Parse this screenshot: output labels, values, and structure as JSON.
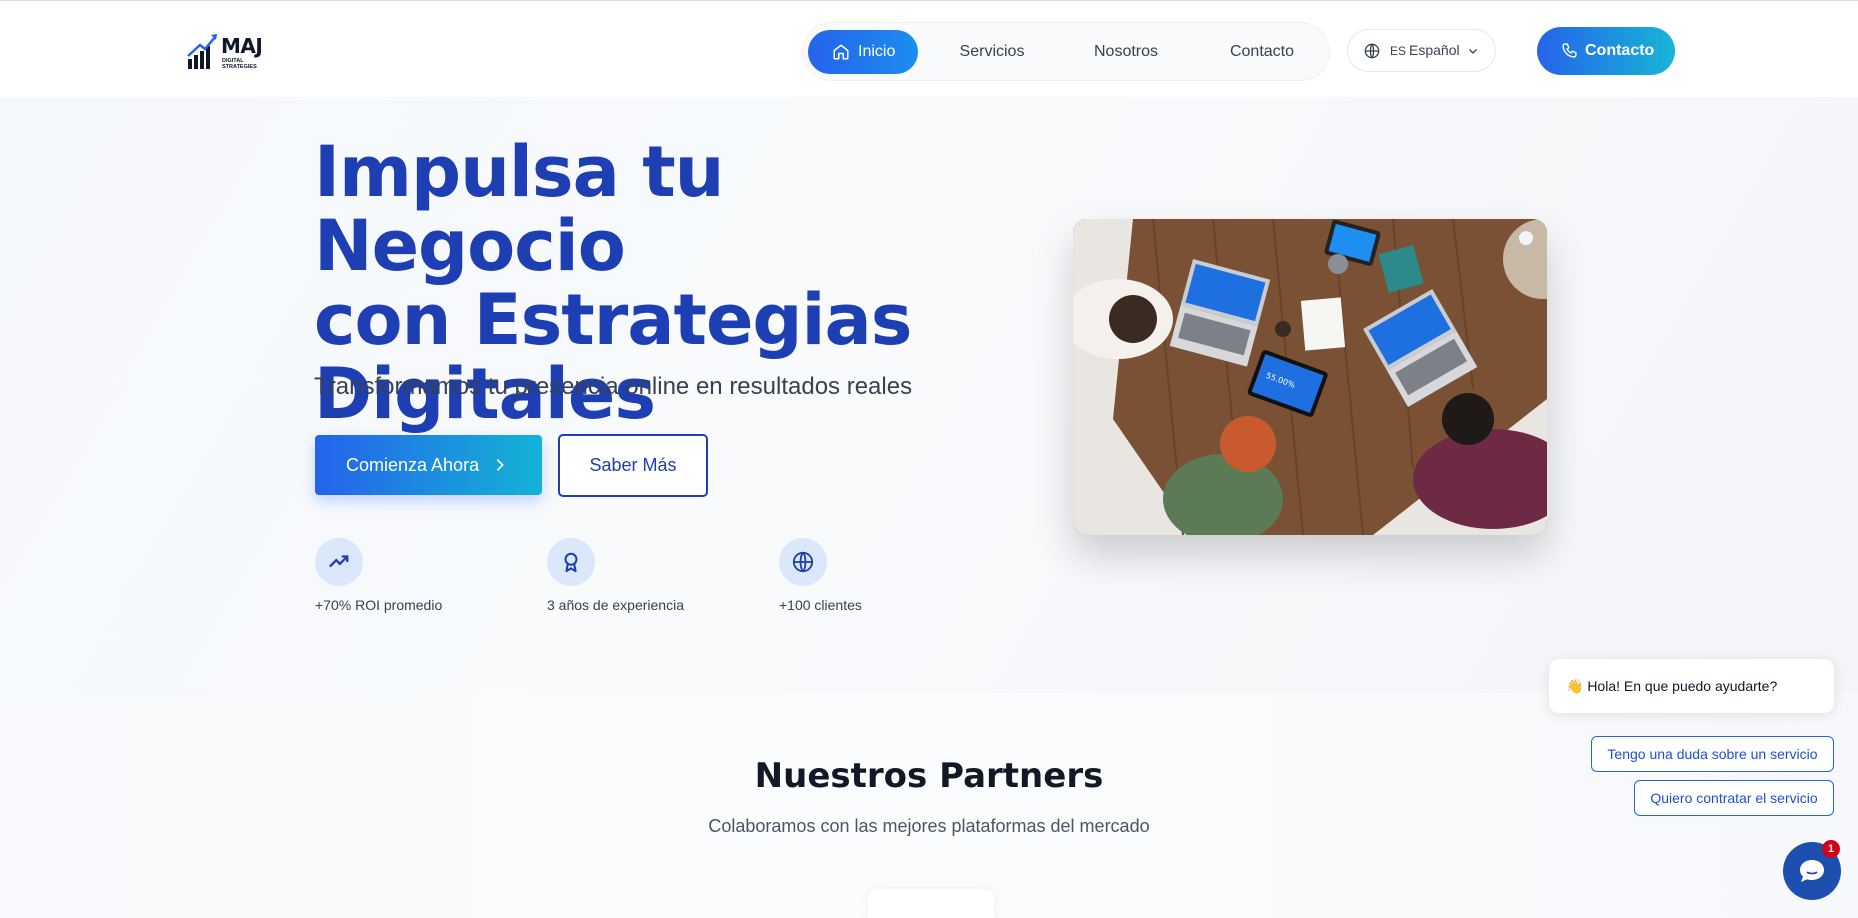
{
  "brand": {
    "name": "MAJ",
    "tagline": "DIGITAL STRATEGIES"
  },
  "nav": {
    "items": [
      "Inicio",
      "Servicios",
      "Nosotros",
      "Contacto"
    ],
    "active": "Inicio"
  },
  "language": {
    "code": "ES",
    "label": "Español"
  },
  "header_contact": "Contacto",
  "hero": {
    "title_lines": [
      "Impulsa tu Negocio",
      "con Estrategias",
      "Digitales"
    ],
    "subtitle": "Transformamos tu presencia online en resultados reales",
    "primary_cta": "Comienza Ahora",
    "secondary_cta": "Saber Más",
    "stats": [
      {
        "icon": "trending-up-icon",
        "label": "+70% ROI promedio"
      },
      {
        "icon": "award-icon",
        "label": "3 años de experiencia"
      },
      {
        "icon": "globe-icon",
        "label": "+100 clientes"
      }
    ]
  },
  "partners": {
    "title": "Nuestros Partners",
    "subtitle": "Colaboramos con las mejores plataformas del mercado"
  },
  "chat": {
    "greeting": "👋 Hola! En que puedo ayudarte?",
    "options": [
      "Tengo una duda sobre un servicio",
      "Quiero contratar el servicio"
    ],
    "badge": "1"
  },
  "colors": {
    "accent": "#2563eb",
    "heading": "#1e3fb4",
    "gradient_end": "#13b3d5"
  }
}
